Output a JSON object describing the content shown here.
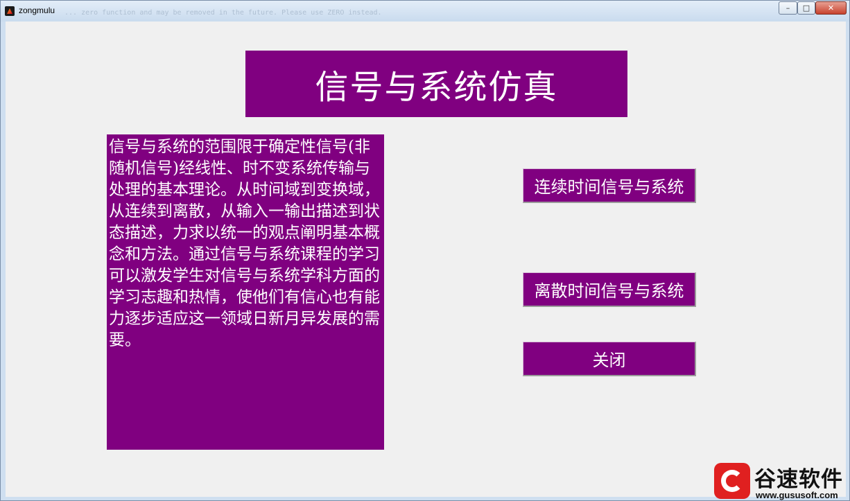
{
  "window": {
    "title": "zongmulu",
    "background_text": "... zero function and may be removed in the future. Please use ZERO instead.",
    "controls": {
      "minimize": "–",
      "maximize": "□",
      "close": "✕"
    }
  },
  "header": {
    "title": "信号与系统仿真"
  },
  "description": {
    "text": "信号与系统的范围限于确定性信号(非随机信号)经线性、时不变系统传输与处理的基本理论。从时间域到变换域，从连续到离散，从输入一输出描述到状态描述，力求以统一的观点阐明基本概念和方法。通过信号与系统课程的学习可以激发学生对信号与系统学科方面的学习志趣和热情，使他们有信心也有能力逐步适应这一领域日新月异发展的需要。"
  },
  "buttons": {
    "continuous": "连续时间信号与系统",
    "discrete": "离散时间信号与系统",
    "close": "关闭"
  },
  "watermark": {
    "name": "谷速软件",
    "url": "www.gususoft.com"
  },
  "colors": {
    "panel": "#800080",
    "client_bg": "#f0f0f0",
    "text": "#ffffff"
  }
}
